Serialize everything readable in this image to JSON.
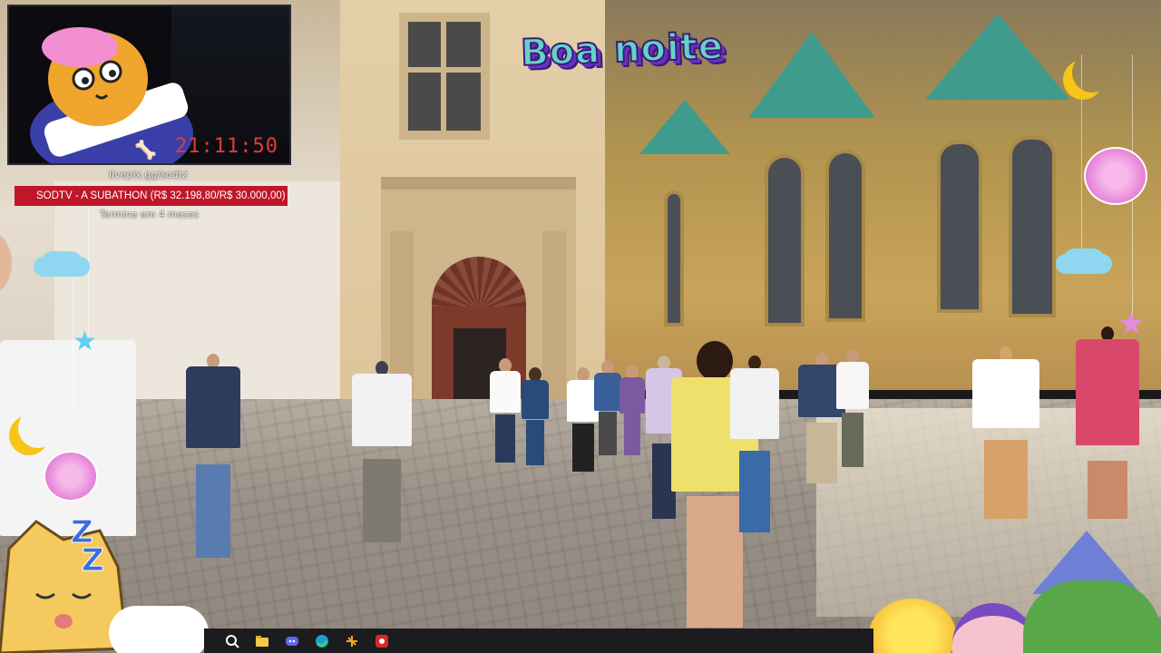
{
  "stream_overlay": {
    "timer": "21:11:50",
    "link": "livepix.gg/sodtz",
    "subathon_label": "SODTV - A SUBATHON (R$ 32.198,80/R$ 30.000,00)",
    "subathon_ends": "Termina em 4 meses",
    "greeting": "Boa noite"
  },
  "taskbar": {
    "icons": [
      "search-icon",
      "file-explorer-icon",
      "discord-icon",
      "edge-browser-icon",
      "app-icon",
      "obs-record-icon"
    ]
  },
  "colors": {
    "subathon_bar": "#c0162a",
    "timer": "#e23b3b",
    "greeting_fill": "#63d3c8",
    "greeting_outline": "#3b1a78",
    "taskbar": "#1c1c1e"
  }
}
